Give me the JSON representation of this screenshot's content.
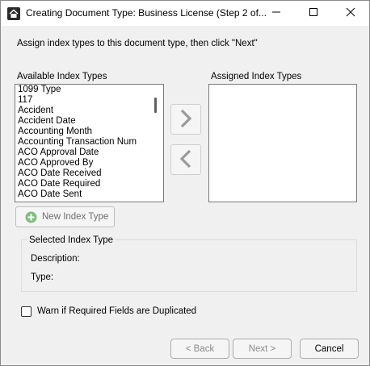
{
  "window": {
    "title": "Creating Document Type: Business License (Step 2 of...",
    "icons": {
      "app": "app-logo-icon",
      "minimize": "minimize-icon",
      "maximize": "maximize-icon",
      "close": "close-icon"
    }
  },
  "instruction": "Assign index types to this document type, then click \"Next\"",
  "available": {
    "label": "Available Index Types",
    "items": [
      "1099 Type",
      "117",
      "Accident",
      "Accident Date",
      "Accounting Month",
      "Accounting Transaction Num",
      "ACO Approval Date",
      "ACO Approved By",
      "ACO Date Received",
      "ACO Date Required",
      "ACO Date Sent"
    ]
  },
  "assigned": {
    "label": "Assigned Index Types",
    "items": []
  },
  "buttons": {
    "add_icon": "chevron-right-icon",
    "remove_icon": "chevron-left-icon",
    "new_index_type": "New Index Type",
    "new_index_icon": "plus-circle-icon",
    "back": "< Back",
    "next": "Next >",
    "cancel": "Cancel"
  },
  "selected_index_type": {
    "title": "Selected Index Type",
    "description_label": "Description:",
    "type_label": "Type:"
  },
  "warn_checkbox": {
    "label": "Warn if Required Fields are Duplicated",
    "checked": false
  },
  "colors": {
    "title_bar": "#ffffff",
    "dialog_bg": "#f0f0f0",
    "disabled_text": "#8c8c8c",
    "plus_green": "#7fbf7f"
  }
}
